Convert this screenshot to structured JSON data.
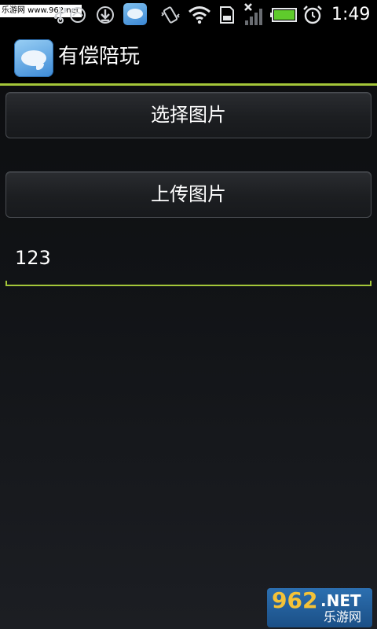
{
  "status_bar": {
    "watermark": "乐游网 www.962.net",
    "time": "1:49",
    "icons": [
      "usb-icon",
      "headset-icon",
      "download-icon",
      "app-notification-icon",
      "vibrate-icon",
      "wifi-icon",
      "sd-card-icon",
      "no-signal-icon",
      "battery-icon",
      "alarm-icon"
    ],
    "accent": "#a4c639"
  },
  "header": {
    "app_icon": "app-logo-icon",
    "title": "有偿陪玩"
  },
  "main": {
    "select_button_label": "选择图片",
    "upload_button_label": "上传图片",
    "text_field_value": "123"
  },
  "watermark_bottom": {
    "number": "962",
    "suffix": ".NET",
    "site": "乐游网"
  }
}
